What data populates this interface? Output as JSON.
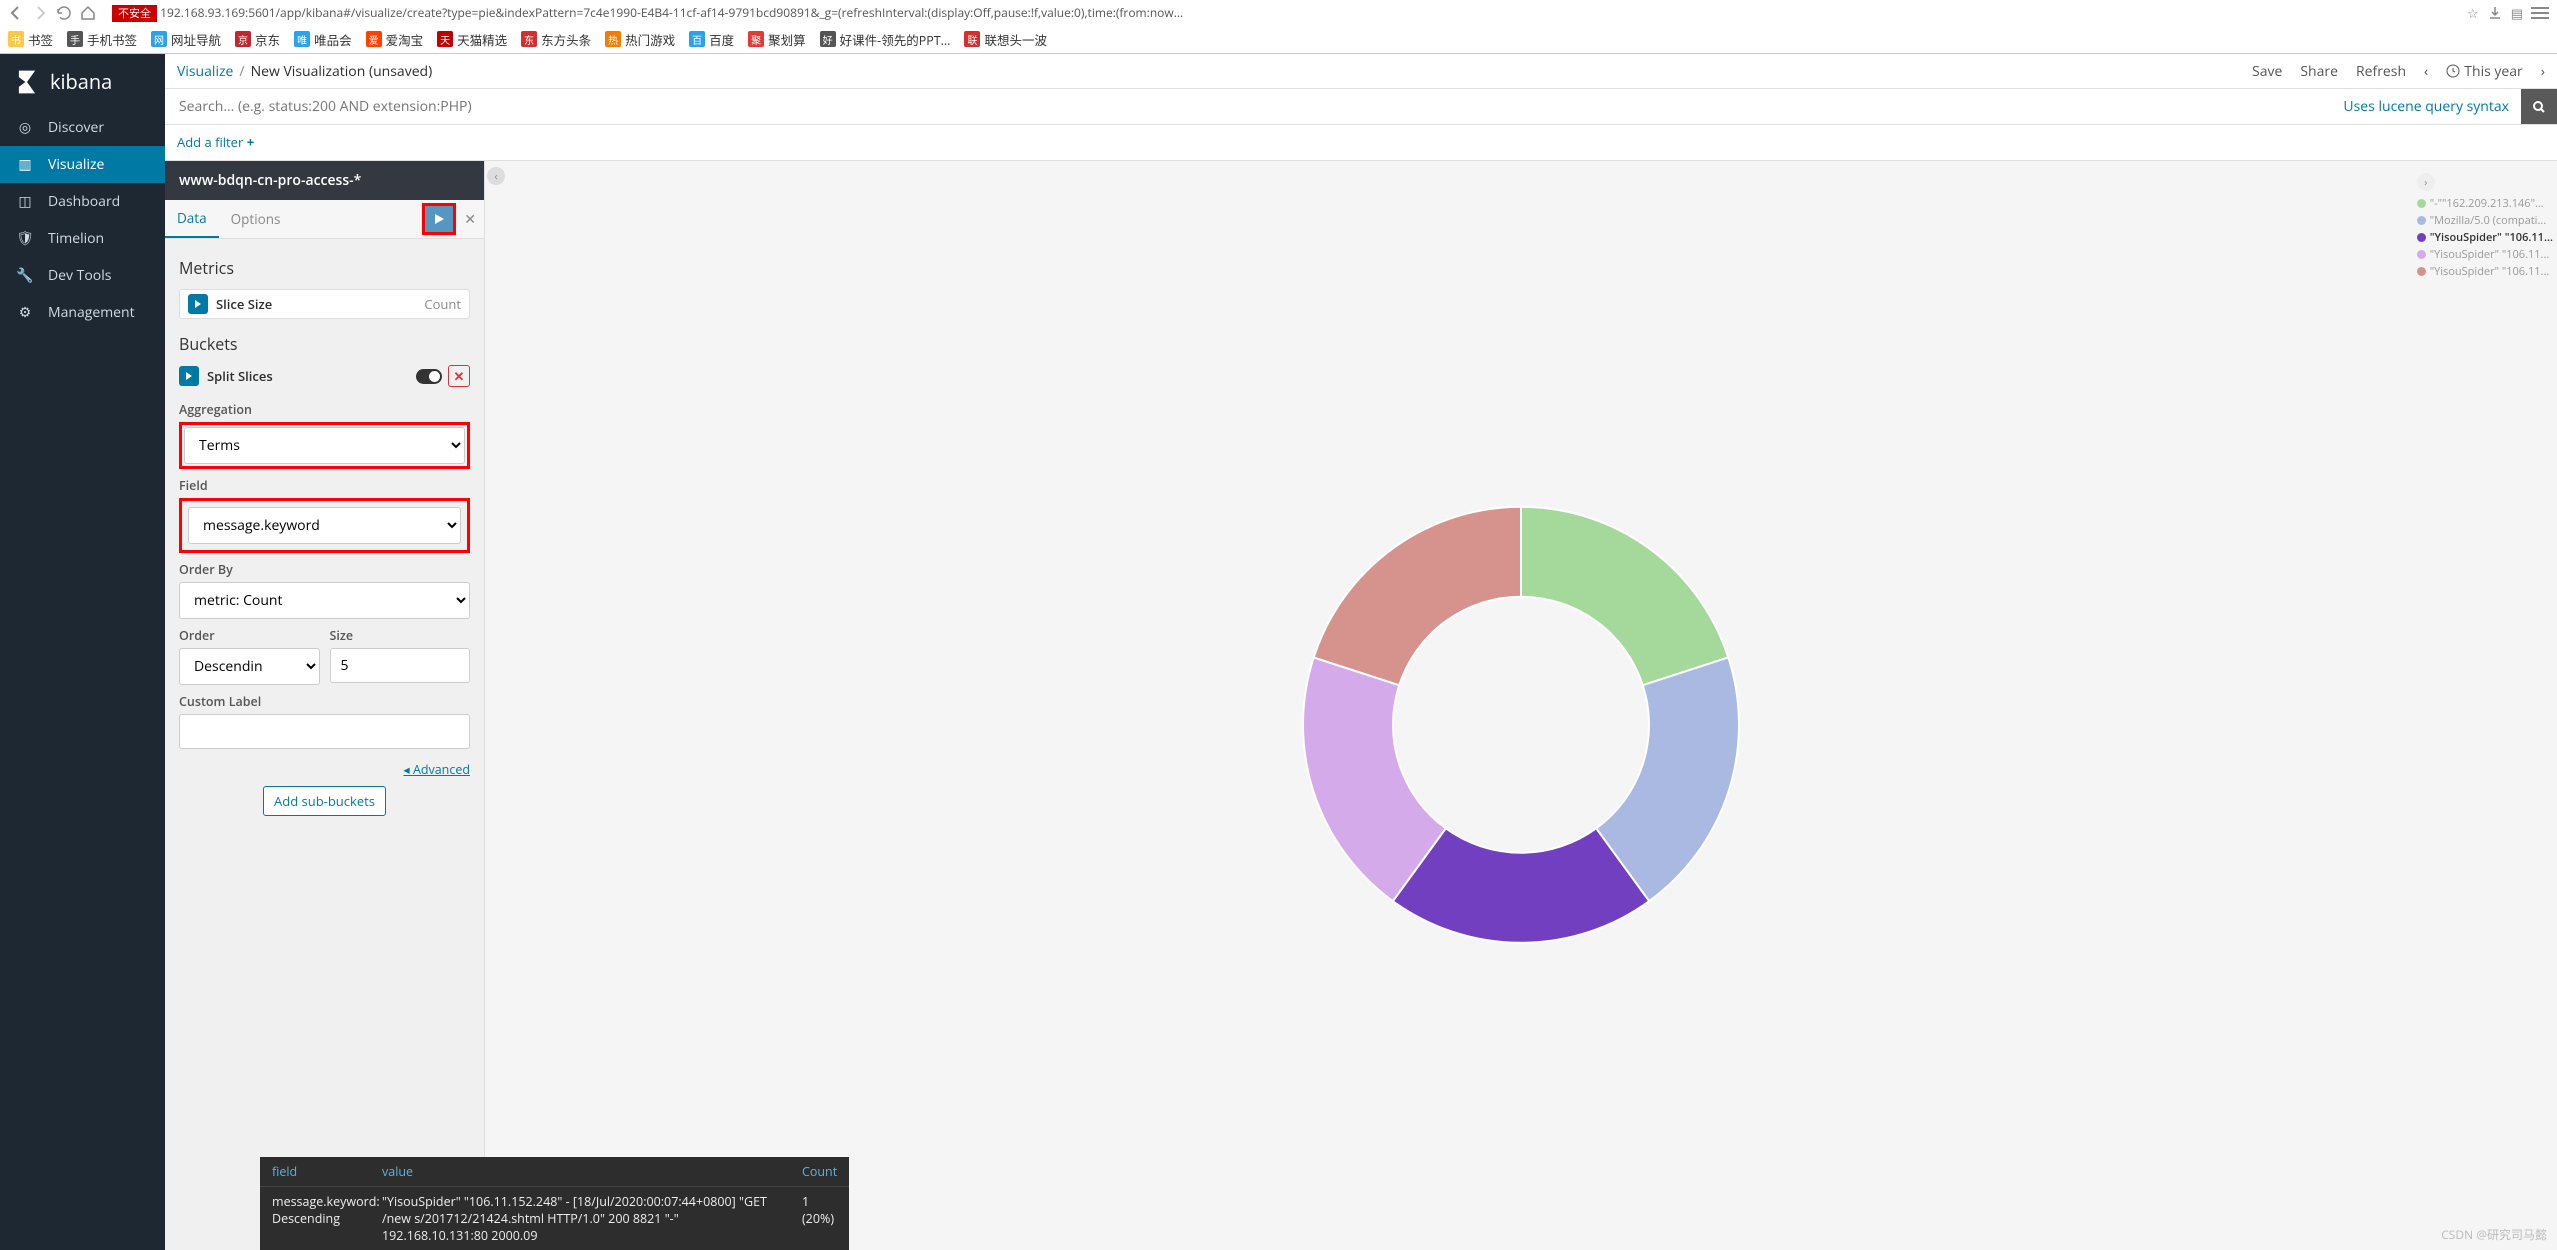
{
  "browser": {
    "danger": "不安全",
    "url": "192.168.93.169:5601/app/kibana#/visualize/create?type=pie&indexPattern=7c4e1990-E4B4-11cf-af14-9791bcd90891&_g=(refreshInterval:(display:Off,pause:!f,value:0),time:(from:now...",
    "bookmarks": [
      {
        "label": "书签",
        "color": "#f9c846"
      },
      {
        "label": "手机书签",
        "color": "#555"
      },
      {
        "label": "网址导航",
        "color": "#2aa3ef"
      },
      {
        "label": "京东",
        "color": "#c1272d"
      },
      {
        "label": "唯品会",
        "color": "#2aa3ef"
      },
      {
        "label": "爱淘宝",
        "color": "#ff4200"
      },
      {
        "label": "天猫精选",
        "color": "#c10000"
      },
      {
        "label": "东方头条",
        "color": "#d32f2f"
      },
      {
        "label": "热门游戏",
        "color": "#f57c00"
      },
      {
        "label": "百度",
        "color": "#2aa3ef"
      },
      {
        "label": "聚划算",
        "color": "#e53935"
      },
      {
        "label": "好课件-领先的PPT...",
        "color": "#555"
      },
      {
        "label": "联想头一波",
        "color": "#d32f2f"
      }
    ]
  },
  "sidebar": {
    "brand": "kibana",
    "items": [
      {
        "label": "Discover"
      },
      {
        "label": "Visualize"
      },
      {
        "label": "Dashboard"
      },
      {
        "label": "Timelion"
      },
      {
        "label": "Dev Tools"
      },
      {
        "label": "Management"
      }
    ]
  },
  "header": {
    "crumb_root": "Visualize",
    "crumb_current": "New Visualization (unsaved)",
    "actions": {
      "save": "Save",
      "share": "Share",
      "refresh": "Refresh",
      "range": "This year"
    }
  },
  "search": {
    "placeholder": "Search... (e.g. status:200 AND extension:PHP)",
    "lucene": "Uses lucene query syntax"
  },
  "filter": {
    "add": "Add a filter"
  },
  "config": {
    "index": "www-bdqn-cn-pro-access-*",
    "tabs": {
      "data": "Data",
      "options": "Options"
    },
    "metrics_title": "Metrics",
    "metric": {
      "name": "Slice Size",
      "meta": "Count"
    },
    "buckets_title": "Buckets",
    "bucket": {
      "name": "Split Slices"
    },
    "labels": {
      "agg": "Aggregation",
      "field": "Field",
      "orderby": "Order By",
      "order": "Order",
      "size": "Size",
      "custom": "Custom Label"
    },
    "values": {
      "agg": "Terms",
      "field": "message.keyword",
      "orderby": "metric: Count",
      "order": "Descendin",
      "size": "5"
    },
    "advanced": "Advanced",
    "addsub": "Add sub-buckets"
  },
  "chart_data": {
    "type": "pie",
    "title": "",
    "series": [
      {
        "name": "\"-\"\"162.209.213.146\"...",
        "value": 20,
        "color": "#a5d99c"
      },
      {
        "name": "\"Mozilla/5.0 (compati...",
        "value": 20,
        "color": "#a9b9e2"
      },
      {
        "name": "\"YisouSpider\" \"106.11...",
        "value": 20,
        "color": "#713fbf"
      },
      {
        "name": "\"YisouSpider\" \"106.11...",
        "value": 20,
        "color": "#d4aaea"
      },
      {
        "name": "\"YisouSpider\" \"106.11...",
        "value": 20,
        "color": "#d6938e"
      }
    ],
    "legend_active_index": 2
  },
  "tooltip": {
    "h_field": "field",
    "h_value": "value",
    "h_count": "Count",
    "field": "message.keyword: Descending",
    "value": "\"YisouSpider\" \"106.11.152.248\" - [18/Jul/2020:00:07:44+0800] \"GET /new s/201712/21424.shtml HTTP/1.0\" 200 8821 \"-\" 192.168.10.131:80 2000.09",
    "count": "1",
    "pct": "(20%)"
  },
  "watermark": "CSDN @研究司马懿"
}
